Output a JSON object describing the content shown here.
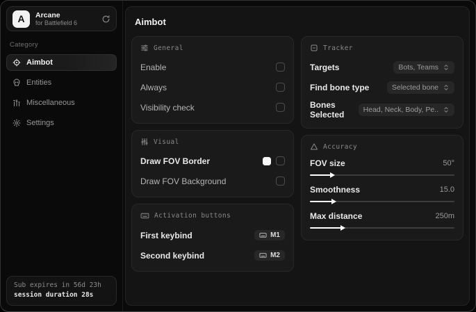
{
  "sidebar": {
    "logo_letter": "A",
    "app_name": "Arcane",
    "app_subtitle": "for Battlefield 6",
    "category_label": "Category",
    "nav": [
      {
        "label": "Aimbot",
        "icon": "crosshair-icon",
        "active": true
      },
      {
        "label": "Entities",
        "icon": "skull-icon",
        "active": false
      },
      {
        "label": "Miscellaneous",
        "icon": "bars-icon",
        "active": false
      },
      {
        "label": "Settings",
        "icon": "gear-icon",
        "active": false
      }
    ],
    "footer": {
      "line1": "Sub expires in 56d 23h",
      "line2": "session duration 28s"
    }
  },
  "main": {
    "title": "Aimbot",
    "general": {
      "title": "General",
      "rows": [
        {
          "label": "Enable",
          "checked": false
        },
        {
          "label": "Always",
          "checked": false
        },
        {
          "label": "Visibility check",
          "checked": false
        }
      ]
    },
    "visual": {
      "title": "Visual",
      "rows": [
        {
          "label": "Draw FOV Border",
          "swatch_color": "#ffffff",
          "checked": false
        },
        {
          "label": "Draw FOV Background",
          "checked": false
        }
      ]
    },
    "activation": {
      "title": "Activation buttons",
      "rows": [
        {
          "label": "First keybind",
          "key": "M1"
        },
        {
          "label": "Second keybind",
          "key": "M2"
        }
      ]
    },
    "tracker": {
      "title": "Tracker",
      "rows": [
        {
          "label": "Targets",
          "value": "Bots, Teams"
        },
        {
          "label": "Find bone type",
          "value": "Selected bone"
        },
        {
          "label": "Bones Selected",
          "value": "Head, Neck, Body, Pe.."
        }
      ]
    },
    "accuracy": {
      "title": "Accuracy",
      "sliders": [
        {
          "label": "FOV size",
          "value": "50°",
          "percent": 15
        },
        {
          "label": "Smoothness",
          "value": "15.0",
          "percent": 16
        },
        {
          "label": "Max distance",
          "value": "250m",
          "percent": 22
        }
      ]
    }
  },
  "colors": {
    "accent_swatch": "#ffffff",
    "card_bg": "#1a1a1a",
    "panel_bg": "#141414"
  }
}
